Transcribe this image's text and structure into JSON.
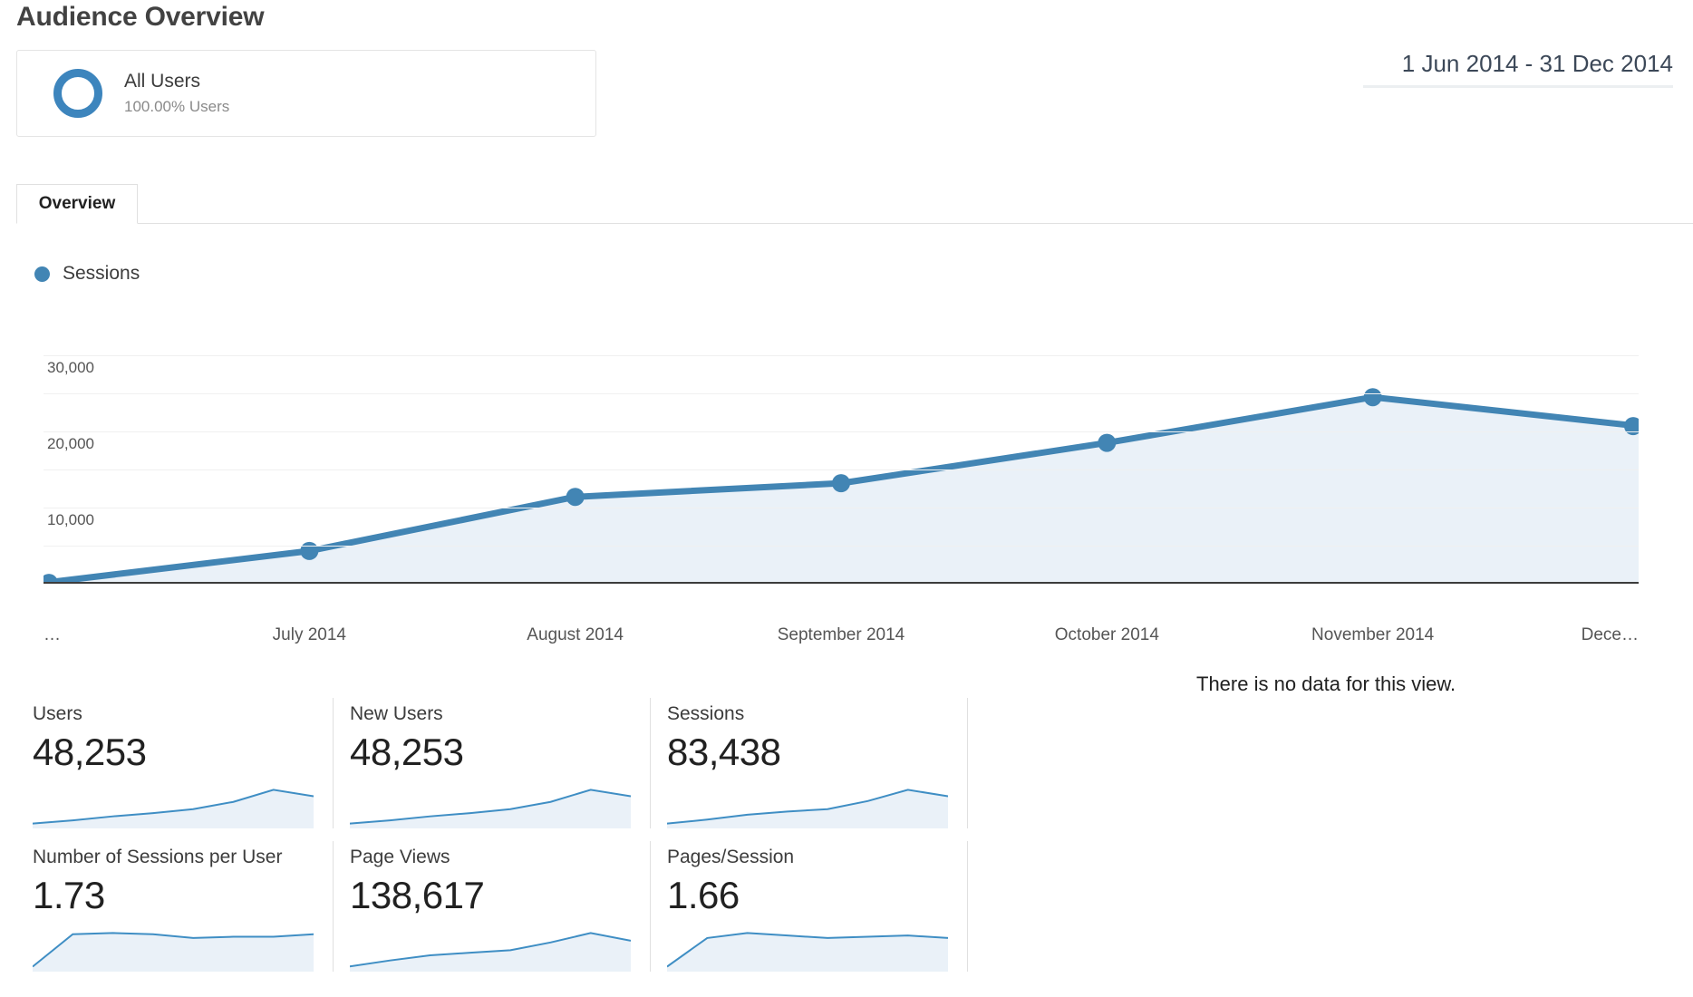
{
  "header": {
    "title": "Audience Overview",
    "segment": {
      "name": "All Users",
      "sub": "100.00% Users",
      "ring_color": "#3d85bd"
    },
    "date_range": "1 Jun 2014 - 31 Dec 2014"
  },
  "tabs": [
    {
      "label": "Overview",
      "active": true
    }
  ],
  "main_chart": {
    "legend_label": "Sessions",
    "accent_color": "#4285b4",
    "area_color": "#eaf1f8"
  },
  "chart_data": {
    "type": "line",
    "title": "Sessions",
    "xlabel": "",
    "ylabel": "Sessions",
    "ylim": [
      0,
      30000
    ],
    "yticks": [
      0,
      5000,
      10000,
      15000,
      20000,
      25000,
      30000
    ],
    "ytick_labels": [
      "",
      "",
      "10,000",
      "",
      "20,000",
      "",
      "30,000"
    ],
    "grid": true,
    "legend_position": "top-left",
    "categories": [
      "…",
      "July 2014",
      "August 2014",
      "September 2014",
      "October 2014",
      "November 2014",
      "Dece…"
    ],
    "series": [
      {
        "name": "Sessions",
        "values": [
          100,
          4300,
          11400,
          13200,
          18500,
          24500,
          20700
        ]
      }
    ]
  },
  "no_data_message": "There is no data for this view.",
  "metric_cards": [
    {
      "label": "Users",
      "value": "48,253",
      "spark": [
        6,
        10,
        15,
        19,
        24,
        33,
        48,
        40
      ]
    },
    {
      "label": "New Users",
      "value": "48,253",
      "spark": [
        6,
        10,
        15,
        19,
        24,
        33,
        48,
        40
      ]
    },
    {
      "label": "Sessions",
      "value": "83,438",
      "spark": [
        6,
        11,
        17,
        21,
        24,
        34,
        48,
        40
      ]
    },
    {
      "label": "Number of Sessions per User",
      "value": "1.73",
      "spark": [
        4,
        30,
        31,
        30,
        27,
        28,
        28,
        30
      ]
    },
    {
      "label": "Page Views",
      "value": "138,617",
      "spark": [
        6,
        13,
        19,
        22,
        25,
        34,
        45,
        36
      ]
    },
    {
      "label": "Pages/Session",
      "value": "1.66",
      "spark": [
        4,
        27,
        31,
        29,
        27,
        28,
        29,
        27
      ]
    }
  ]
}
